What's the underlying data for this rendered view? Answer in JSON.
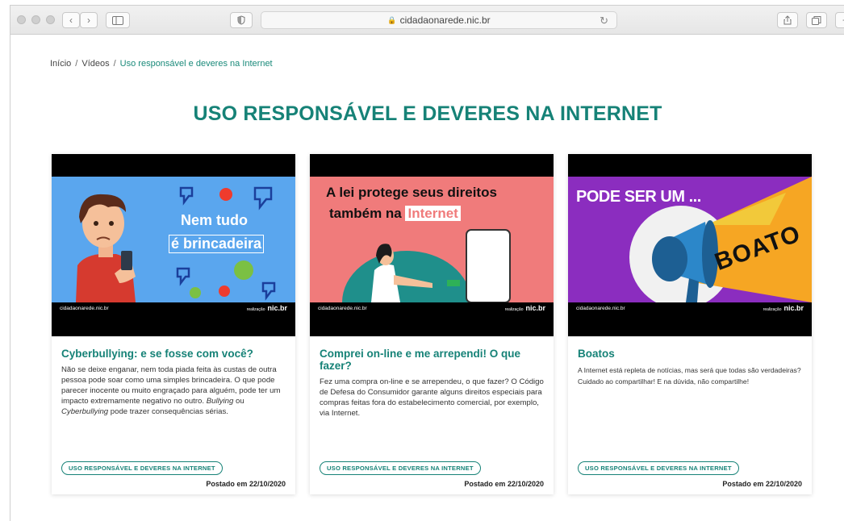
{
  "browser": {
    "url": "cidadaonarede.nic.br"
  },
  "breadcrumb": {
    "home": "Início",
    "section": "Vídeos",
    "current": "Uso responsável e deveres na Internet",
    "sep": "/"
  },
  "page": {
    "title": "USO RESPONSÁVEL E DEVERES NA INTERNET"
  },
  "colors": {
    "accent": "#168277",
    "card1_bg": "#5aa6ee",
    "card2_bg": "#f07b7b",
    "card3_bg": "#8b2dbf"
  },
  "cards": [
    {
      "thumb_line1": "Nem tudo",
      "thumb_line2": "é brincadeira",
      "footer_left": "cidadaonarede.nic.br",
      "footer_right_small": "realização",
      "footer_right": "nic.br",
      "title": "Cyberbullying: e se fosse com você?",
      "desc_a": "Não se deixe enganar, nem toda piada feita às custas de outra pessoa pode soar como uma simples brincadeira. O que pode parecer inocente ou muito engraçado para alguém, pode ter um impacto extremamente negativo no outro. ",
      "desc_b": "Bullying",
      "desc_c": " ou ",
      "desc_d": "Cyberbullying",
      "desc_e": " pode trazer consequências sérias.",
      "tag": "USO RESPONSÁVEL E DEVERES NA INTERNET",
      "posted_label": "Postado em",
      "posted_date": "22/10/2020"
    },
    {
      "thumb_line1": "A lei protege seus direitos",
      "thumb_line2a": "também na",
      "thumb_line2b": "Internet",
      "footer_left": "cidadaonarede.nic.br",
      "footer_right_small": "realização",
      "footer_right": "nic.br",
      "title": "Comprei on-line e me arrependi! O que fazer?",
      "desc": "Fez uma compra on-line e se arrependeu, o que fazer? O Código de Defesa do Consumidor garante alguns direitos especiais para compras feitas fora do estabelecimento comercial, por exemplo, via Internet.",
      "tag": "USO RESPONSÁVEL E DEVERES NA INTERNET",
      "posted_label": "Postado em",
      "posted_date": "22/10/2020"
    },
    {
      "thumb_line1": "PODE SER UM ...",
      "thumb_word": "BOATO",
      "footer_left": "cidadaonarede.nic.br",
      "footer_right_small": "realização",
      "footer_right": "nic.br",
      "title": "Boatos",
      "desc": "A Internet está repleta de notícias, mas será que todas são verdadeiras? Cuidado ao compartilhar! E na dúvida, não compartilhe!",
      "tag": "USO RESPONSÁVEL E DEVERES NA INTERNET",
      "posted_label": "Postado em",
      "posted_date": "22/10/2020"
    }
  ]
}
